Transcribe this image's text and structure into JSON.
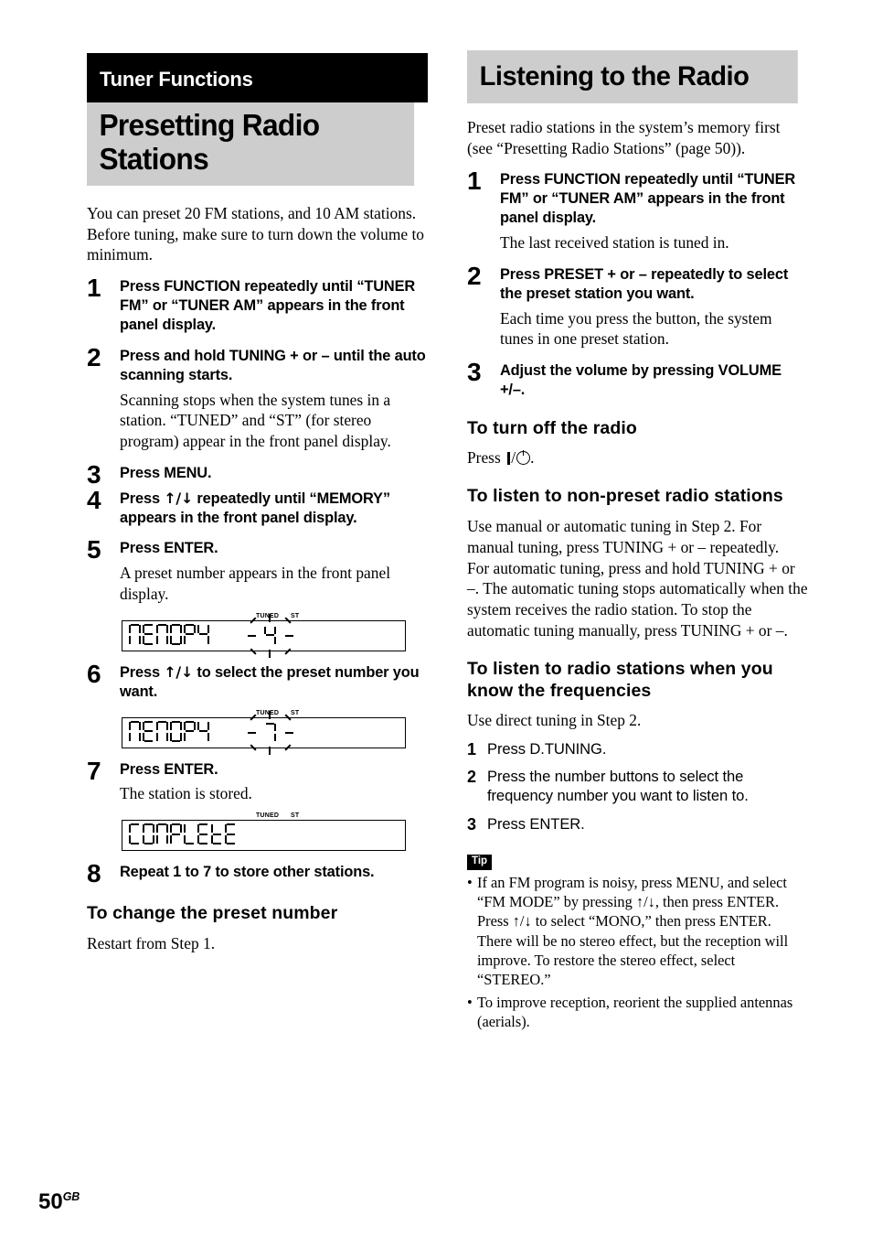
{
  "page": {
    "number": "50",
    "region_suffix": "GB"
  },
  "left_column": {
    "chapter_banner": "Tuner Functions",
    "section_title": "Presetting Radio Stations",
    "intro": "You can preset 20 FM stations, and 10 AM stations. Before tuning, make sure to turn down the volume to minimum.",
    "steps": [
      {
        "num": "1",
        "title": "Press FUNCTION repeatedly until “TUNER FM” or “TUNER AM” appears in the front panel display.",
        "desc": ""
      },
      {
        "num": "2",
        "title": "Press and hold TUNING + or – until the auto scanning starts.",
        "desc": "Scanning stops when the system tunes in a station. “TUNED” and “ST” (for stereo program) appear in the front panel display."
      },
      {
        "num": "3",
        "title": "Press MENU.",
        "desc": ""
      },
      {
        "num": "4",
        "title_pre": "Press ",
        "title_arrows": "↑/↓",
        "title_post": " repeatedly until “MEMORY” appears in the front panel display.",
        "desc": ""
      },
      {
        "num": "5",
        "title": "Press ENTER.",
        "desc": "A preset number appears in the front panel display."
      },
      {
        "num": "6",
        "title_pre": "Press ",
        "title_arrows": "↑/↓",
        "title_post": " to select the preset number you want.",
        "desc": ""
      },
      {
        "num": "7",
        "title": "Press ENTER.",
        "desc": "The station is stored."
      },
      {
        "num": "8",
        "title": "Repeat 1 to 7 to store other stations.",
        "desc": ""
      }
    ],
    "displays": [
      {
        "word": "MEMORY",
        "indicator_tuned": "TUNED",
        "indicator_st": "ST",
        "preset": "4",
        "blinking": true
      },
      {
        "word": "MEMORY",
        "indicator_tuned": "TUNED",
        "indicator_st": "ST",
        "preset": "7",
        "blinking": true
      },
      {
        "word": "COMPLETE",
        "indicator_tuned": "TUNED",
        "indicator_st": "ST",
        "preset": "",
        "blinking": false
      }
    ],
    "subsection": {
      "heading": "To change the preset number",
      "text": "Restart from Step 1."
    }
  },
  "right_column": {
    "section_title": "Listening to the Radio",
    "intro": "Preset radio stations in the system’s memory first (see “Presetting Radio Stations” (page 50)).",
    "steps": [
      {
        "num": "1",
        "title": "Press FUNCTION repeatedly until “TUNER FM” or “TUNER AM” appears in the front panel display.",
        "desc": "The last received station is tuned in."
      },
      {
        "num": "2",
        "title": "Press PRESET + or – repeatedly to select the preset station you want.",
        "desc": "Each time you press the button, the system tunes in one preset station."
      },
      {
        "num": "3",
        "title": "Adjust the volume by pressing VOLUME +/–.",
        "desc": ""
      }
    ],
    "turn_off": {
      "heading": "To turn off the radio",
      "text_pre": "Press ",
      "text_post": "."
    },
    "non_preset": {
      "heading": "To listen to non-preset radio stations",
      "text": "Use manual or automatic tuning in Step 2. For manual tuning, press TUNING + or – repeatedly.\nFor automatic tuning, press and hold TUNING + or –. The automatic tuning stops automatically when the system receives the radio station. To stop the automatic tuning manually, press TUNING + or –."
    },
    "frequencies": {
      "heading": "To listen to radio stations when you know the frequencies",
      "text": "Use direct tuning in Step 2.",
      "ministeps": [
        {
          "num": "1",
          "text": "Press D.TUNING."
        },
        {
          "num": "2",
          "text": "Press the number buttons to select the frequency number you want to listen to."
        },
        {
          "num": "3",
          "text": "Press ENTER."
        }
      ]
    },
    "tip": {
      "badge": "Tip",
      "bullets": [
        "If an FM program is noisy, press MENU, and select “FM MODE” by pressing ↑/↓, then press ENTER. Press ↑/↓ to select “MONO,” then press ENTER. There will be no stereo effect, but the reception will improve. To restore the stereo effect, select “STEREO.”",
        "To improve reception, reorient the supplied antennas (aerials)."
      ],
      "bullet_marker": "•"
    }
  },
  "colors": {
    "banner_black": "#000000",
    "banner_grey": "#cdcdcd",
    "text": "#000000",
    "background": "#ffffff"
  }
}
